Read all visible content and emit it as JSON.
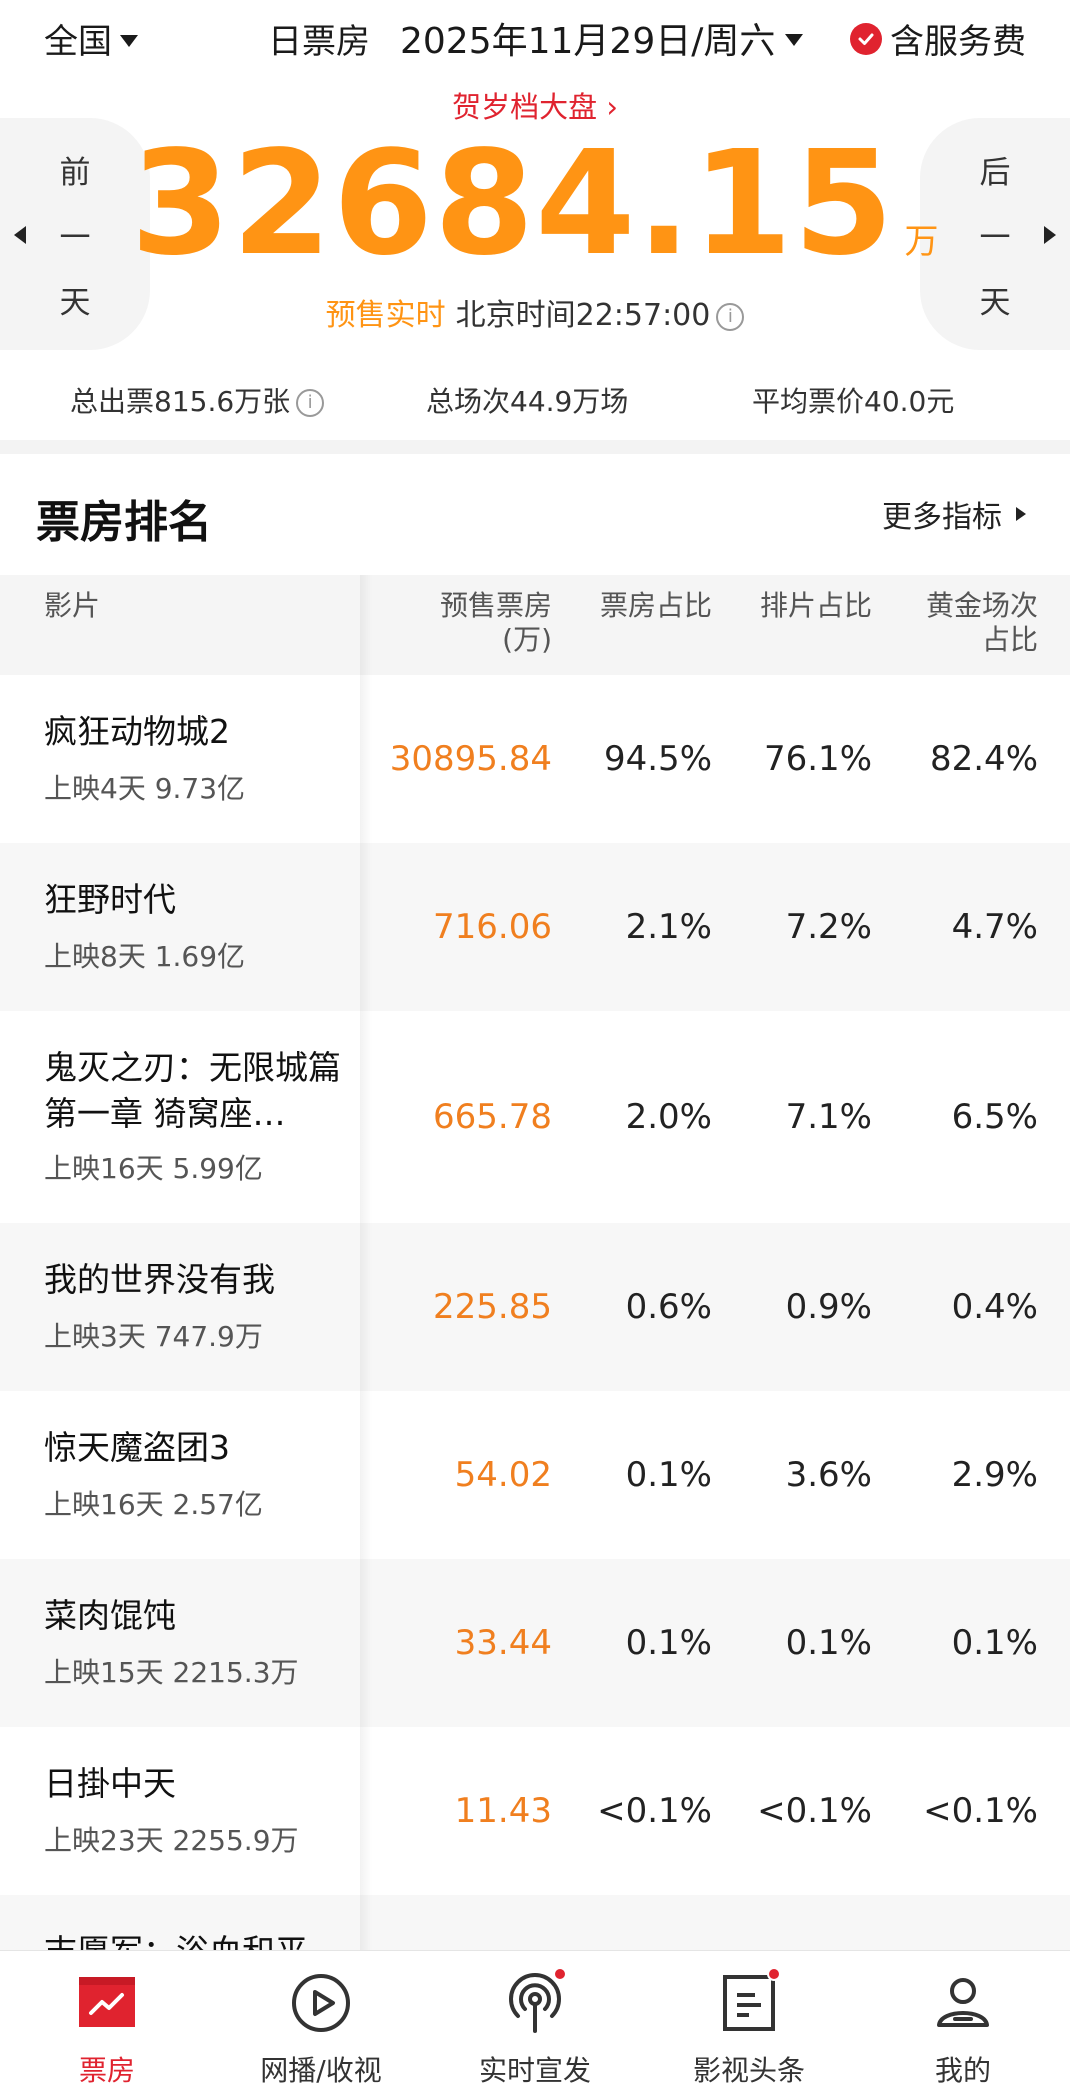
{
  "header": {
    "region": "全国",
    "type": "日票房",
    "date": "2025年11月29日/周六",
    "fee_label": "含服务费"
  },
  "summary": {
    "season_link": "贺岁档大盘",
    "total": "32684.15",
    "unit": "万",
    "presale_label": "预售实时",
    "time_label": "北京时间22:57:00",
    "prev_day": [
      "前",
      "一",
      "天"
    ],
    "next_day": [
      "后",
      "一",
      "天"
    ],
    "tickets": "总出票815.6万张",
    "shows": "总场次44.9万场",
    "avg_price": "平均票价40.0元"
  },
  "ranking": {
    "title": "票房排名",
    "more_label": "更多指标",
    "columns": {
      "film": "影片",
      "box_office_line1": "预售票房",
      "box_office_line2": "(万)",
      "bo_share": "票房占比",
      "show_share": "排片占比",
      "golden_line1": "黄金场次",
      "golden_line2": "占比"
    },
    "rows": [
      {
        "name": "疯狂动物城2",
        "meta": "上映4天  9.73亿",
        "bo": "30895.84",
        "p1": "94.5%",
        "p2": "76.1%",
        "p3": "82.4%"
      },
      {
        "name": "狂野时代",
        "meta": "上映8天  1.69亿",
        "bo": "716.06",
        "p1": "2.1%",
        "p2": "7.2%",
        "p3": "4.7%"
      },
      {
        "name": "鬼灭之刃：无限城篇 第一章 猗窝座…",
        "meta": "上映16天  5.99亿",
        "bo": "665.78",
        "p1": "2.0%",
        "p2": "7.1%",
        "p3": "6.5%"
      },
      {
        "name": "我的世界没有我",
        "meta": "上映3天  747.9万",
        "bo": "225.85",
        "p1": "0.6%",
        "p2": "0.9%",
        "p3": "0.4%"
      },
      {
        "name": "惊天魔盗团3",
        "meta": "上映16天  2.57亿",
        "bo": "54.02",
        "p1": "0.1%",
        "p2": "3.6%",
        "p3": "2.9%"
      },
      {
        "name": "菜肉馄饨",
        "meta": "上映15天  2215.3万",
        "bo": "33.44",
        "p1": "0.1%",
        "p2": "0.1%",
        "p3": "0.1%"
      },
      {
        "name": "日掛中天",
        "meta": "上映23天  2255.9万",
        "bo": "11.43",
        "p1": "<0.1%",
        "p2": "<0.1%",
        "p3": "<0.1%"
      },
      {
        "name": "志愿军：浴血和平",
        "meta": "",
        "bo": "",
        "p1": "",
        "p2": "",
        "p3": ""
      }
    ]
  },
  "nav": {
    "items": [
      {
        "label": "票房",
        "icon": "chart-icon"
      },
      {
        "label": "网播/收视",
        "icon": "play-icon"
      },
      {
        "label": "实时宣发",
        "icon": "broadcast-icon"
      },
      {
        "label": "影视头条",
        "icon": "news-icon"
      },
      {
        "label": "我的",
        "icon": "user-icon"
      }
    ],
    "active_color": "#e0232f"
  }
}
